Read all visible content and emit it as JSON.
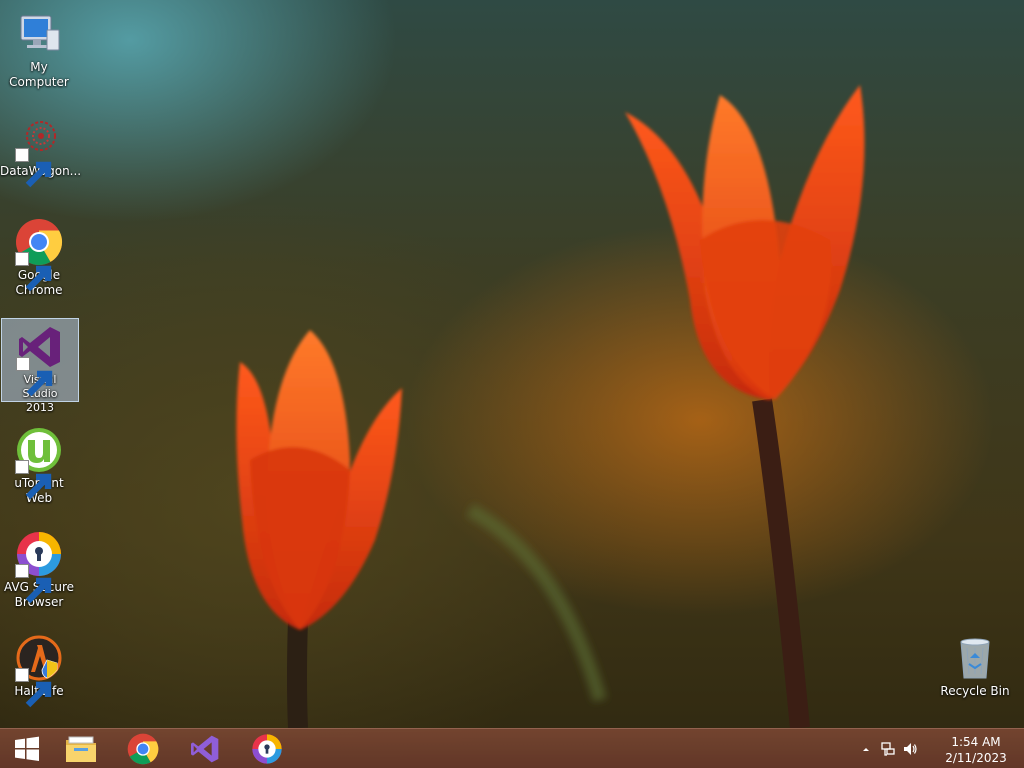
{
  "desktop": {
    "icons": [
      {
        "label": "My Computer",
        "icon": "computer-icon"
      },
      {
        "label": "DataWagon...",
        "icon": "datawagon-icon"
      },
      {
        "label": "Google Chrome",
        "icon": "chrome-icon"
      },
      {
        "label": "Visual Studio 2013",
        "icon": "visual-studio-icon",
        "selected": true
      },
      {
        "label": "uTorrent Web",
        "icon": "utorrent-icon"
      },
      {
        "label": "AVG Secure Browser",
        "icon": "avg-secure-browser-icon"
      },
      {
        "label": "Half-Life",
        "icon": "half-life-icon"
      }
    ],
    "recycle_bin": {
      "label": "Recycle Bin",
      "icon": "recycle-bin-icon"
    }
  },
  "taskbar": {
    "start": {
      "icon": "windows-start-icon"
    },
    "pinned": [
      {
        "icon": "file-explorer-icon"
      },
      {
        "icon": "chrome-icon"
      },
      {
        "icon": "visual-studio-icon"
      },
      {
        "icon": "avg-secure-browser-icon"
      }
    ],
    "tray": {
      "show_hidden": {
        "icon": "chevron-up-icon"
      },
      "network": {
        "icon": "network-icon"
      },
      "volume": {
        "icon": "volume-icon"
      },
      "time": "1:54 AM",
      "date": "2/11/2023"
    }
  },
  "colors": {
    "taskbar": "#6e3e2c",
    "selection": "#b4c8e6",
    "vs_purple": "#68217a"
  }
}
